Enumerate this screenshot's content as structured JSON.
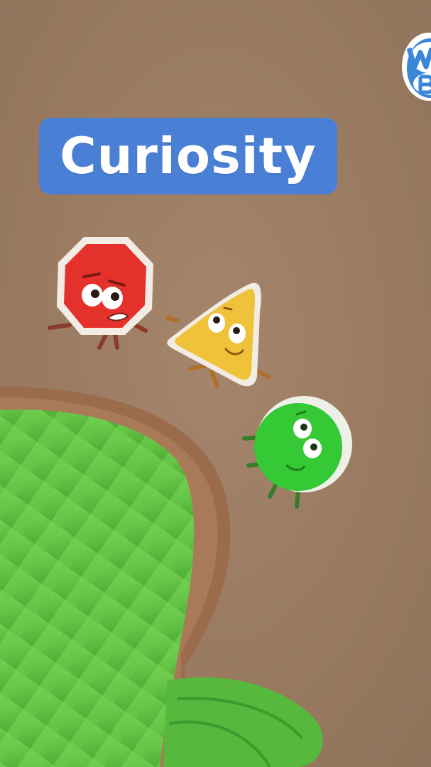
{
  "title": "Curiosity",
  "colors": {
    "background": "#9a7b62",
    "title_chip": "#4a7fd6",
    "title_text": "#ffffff",
    "octagon_character": "#e5312b",
    "triangle_character": "#f0c23a",
    "circle_character": "#34c935",
    "plant_leaf": "#6fcf4a"
  },
  "characters": [
    {
      "shape": "octagon",
      "color": "red"
    },
    {
      "shape": "triangle",
      "color": "yellow"
    },
    {
      "shape": "circle",
      "color": "green"
    }
  ]
}
